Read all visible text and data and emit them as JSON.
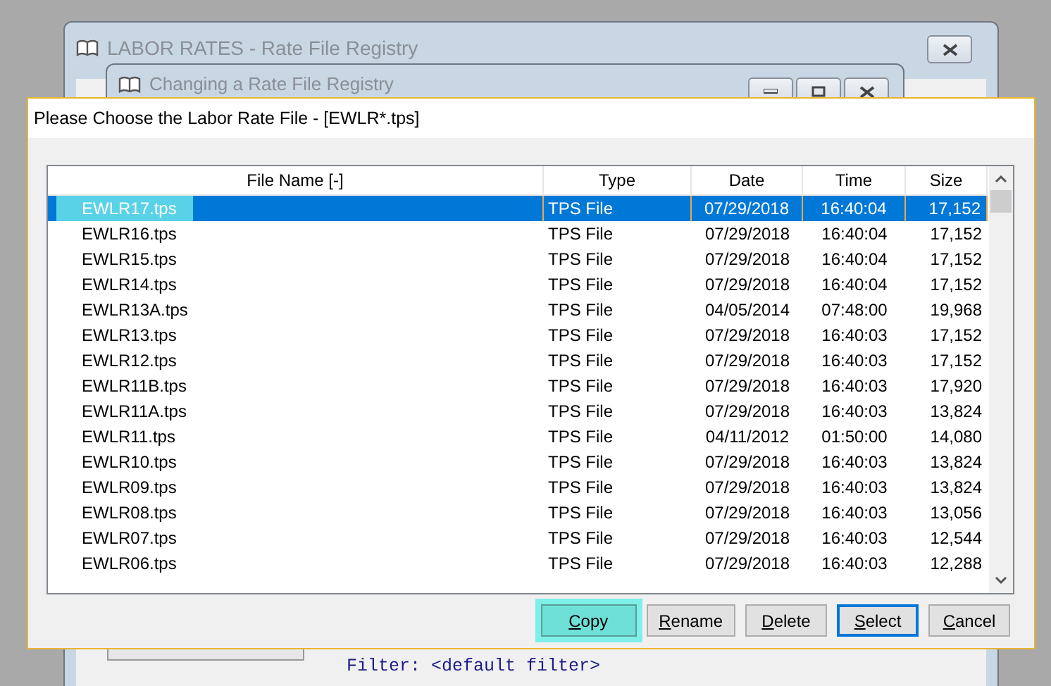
{
  "back_windows": [
    {
      "title": "LABOR RATES - Rate File Registry"
    },
    {
      "title": "Changing a Rate File Registry"
    }
  ],
  "background_controls": {
    "filter_text": "Filter: <default filter>"
  },
  "dialog": {
    "title": "Please Choose the Labor Rate File - [EWLR*.tps]",
    "table": {
      "columns": [
        "File Name [-]",
        "Type",
        "Date",
        "Time",
        "Size"
      ],
      "rows": [
        {
          "cells": [
            "EWLR17.tps",
            "TPS File",
            "07/29/2018",
            "16:40:04",
            "17,152"
          ],
          "selected": true,
          "highlighted": true
        },
        {
          "cells": [
            "EWLR16.tps",
            "TPS File",
            "07/29/2018",
            "16:40:04",
            "17,152"
          ],
          "selected": false,
          "highlighted": false
        },
        {
          "cells": [
            "EWLR15.tps",
            "TPS File",
            "07/29/2018",
            "16:40:04",
            "17,152"
          ],
          "selected": false,
          "highlighted": false
        },
        {
          "cells": [
            "EWLR14.tps",
            "TPS File",
            "07/29/2018",
            "16:40:04",
            "17,152"
          ],
          "selected": false,
          "highlighted": false
        },
        {
          "cells": [
            "EWLR13A.tps",
            "TPS File",
            "04/05/2014",
            "07:48:00",
            "19,968"
          ],
          "selected": false,
          "highlighted": false
        },
        {
          "cells": [
            "EWLR13.tps",
            "TPS File",
            "07/29/2018",
            "16:40:03",
            "17,152"
          ],
          "selected": false,
          "highlighted": false
        },
        {
          "cells": [
            "EWLR12.tps",
            "TPS File",
            "07/29/2018",
            "16:40:03",
            "17,152"
          ],
          "selected": false,
          "highlighted": false
        },
        {
          "cells": [
            "EWLR11B.tps",
            "TPS File",
            "07/29/2018",
            "16:40:03",
            "17,920"
          ],
          "selected": false,
          "highlighted": false
        },
        {
          "cells": [
            "EWLR11A.tps",
            "TPS File",
            "07/29/2018",
            "16:40:03",
            "13,824"
          ],
          "selected": false,
          "highlighted": false
        },
        {
          "cells": [
            "EWLR11.tps",
            "TPS File",
            "04/11/2012",
            "01:50:00",
            "14,080"
          ],
          "selected": false,
          "highlighted": false
        },
        {
          "cells": [
            "EWLR10.tps",
            "TPS File",
            "07/29/2018",
            "16:40:03",
            "13,824"
          ],
          "selected": false,
          "highlighted": false
        },
        {
          "cells": [
            "EWLR09.tps",
            "TPS File",
            "07/29/2018",
            "16:40:03",
            "13,824"
          ],
          "selected": false,
          "highlighted": false
        },
        {
          "cells": [
            "EWLR08.tps",
            "TPS File",
            "07/29/2018",
            "16:40:03",
            "13,056"
          ],
          "selected": false,
          "highlighted": false
        },
        {
          "cells": [
            "EWLR07.tps",
            "TPS File",
            "07/29/2018",
            "16:40:03",
            "12,544"
          ],
          "selected": false,
          "highlighted": false
        },
        {
          "cells": [
            "EWLR06.tps",
            "TPS File",
            "07/29/2018",
            "16:40:03",
            "12,288"
          ],
          "selected": false,
          "highlighted": false
        }
      ]
    },
    "buttons": [
      {
        "label": "Copy",
        "default": false,
        "highlighted": true
      },
      {
        "label": "Rename",
        "default": false,
        "highlighted": false
      },
      {
        "label": "Delete",
        "default": false,
        "highlighted": false
      },
      {
        "label": "Select",
        "default": true,
        "highlighted": false
      },
      {
        "label": "Cancel",
        "default": false,
        "highlighted": false
      }
    ]
  }
}
